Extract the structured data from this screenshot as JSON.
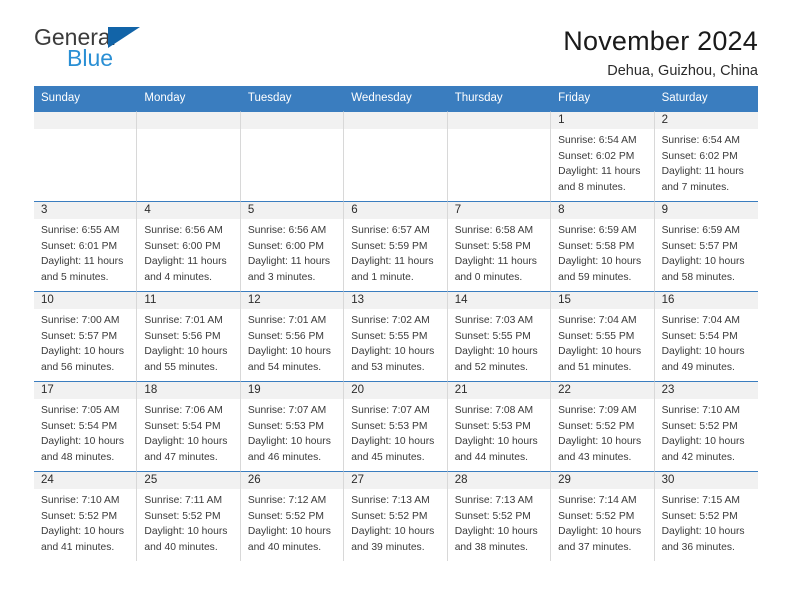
{
  "brand": {
    "word1": "General",
    "word2": "Blue",
    "triangle_color": "#1264a8",
    "word2_color": "#2a8fd4"
  },
  "header": {
    "title": "November 2024",
    "location": "Dehua, Guizhou, China"
  },
  "theme": {
    "header_blue": "#3a7dbf",
    "day_band_gray": "#f1f1f1",
    "text_color": "#3a3a3a"
  },
  "weekdays": [
    "Sunday",
    "Monday",
    "Tuesday",
    "Wednesday",
    "Thursday",
    "Friday",
    "Saturday"
  ],
  "weeks": [
    [
      {
        "day": "",
        "empty": true,
        "sunrise": "",
        "sunset": "",
        "daylight1": "",
        "daylight2": ""
      },
      {
        "day": "",
        "empty": true,
        "sunrise": "",
        "sunset": "",
        "daylight1": "",
        "daylight2": ""
      },
      {
        "day": "",
        "empty": true,
        "sunrise": "",
        "sunset": "",
        "daylight1": "",
        "daylight2": ""
      },
      {
        "day": "",
        "empty": true,
        "sunrise": "",
        "sunset": "",
        "daylight1": "",
        "daylight2": ""
      },
      {
        "day": "",
        "empty": true,
        "sunrise": "",
        "sunset": "",
        "daylight1": "",
        "daylight2": ""
      },
      {
        "day": "1",
        "empty": false,
        "sunrise": "Sunrise: 6:54 AM",
        "sunset": "Sunset: 6:02 PM",
        "daylight1": "Daylight: 11 hours",
        "daylight2": "and 8 minutes."
      },
      {
        "day": "2",
        "empty": false,
        "sunrise": "Sunrise: 6:54 AM",
        "sunset": "Sunset: 6:02 PM",
        "daylight1": "Daylight: 11 hours",
        "daylight2": "and 7 minutes."
      }
    ],
    [
      {
        "day": "3",
        "empty": false,
        "sunrise": "Sunrise: 6:55 AM",
        "sunset": "Sunset: 6:01 PM",
        "daylight1": "Daylight: 11 hours",
        "daylight2": "and 5 minutes."
      },
      {
        "day": "4",
        "empty": false,
        "sunrise": "Sunrise: 6:56 AM",
        "sunset": "Sunset: 6:00 PM",
        "daylight1": "Daylight: 11 hours",
        "daylight2": "and 4 minutes."
      },
      {
        "day": "5",
        "empty": false,
        "sunrise": "Sunrise: 6:56 AM",
        "sunset": "Sunset: 6:00 PM",
        "daylight1": "Daylight: 11 hours",
        "daylight2": "and 3 minutes."
      },
      {
        "day": "6",
        "empty": false,
        "sunrise": "Sunrise: 6:57 AM",
        "sunset": "Sunset: 5:59 PM",
        "daylight1": "Daylight: 11 hours",
        "daylight2": "and 1 minute."
      },
      {
        "day": "7",
        "empty": false,
        "sunrise": "Sunrise: 6:58 AM",
        "sunset": "Sunset: 5:58 PM",
        "daylight1": "Daylight: 11 hours",
        "daylight2": "and 0 minutes."
      },
      {
        "day": "8",
        "empty": false,
        "sunrise": "Sunrise: 6:59 AM",
        "sunset": "Sunset: 5:58 PM",
        "daylight1": "Daylight: 10 hours",
        "daylight2": "and 59 minutes."
      },
      {
        "day": "9",
        "empty": false,
        "sunrise": "Sunrise: 6:59 AM",
        "sunset": "Sunset: 5:57 PM",
        "daylight1": "Daylight: 10 hours",
        "daylight2": "and 58 minutes."
      }
    ],
    [
      {
        "day": "10",
        "empty": false,
        "sunrise": "Sunrise: 7:00 AM",
        "sunset": "Sunset: 5:57 PM",
        "daylight1": "Daylight: 10 hours",
        "daylight2": "and 56 minutes."
      },
      {
        "day": "11",
        "empty": false,
        "sunrise": "Sunrise: 7:01 AM",
        "sunset": "Sunset: 5:56 PM",
        "daylight1": "Daylight: 10 hours",
        "daylight2": "and 55 minutes."
      },
      {
        "day": "12",
        "empty": false,
        "sunrise": "Sunrise: 7:01 AM",
        "sunset": "Sunset: 5:56 PM",
        "daylight1": "Daylight: 10 hours",
        "daylight2": "and 54 minutes."
      },
      {
        "day": "13",
        "empty": false,
        "sunrise": "Sunrise: 7:02 AM",
        "sunset": "Sunset: 5:55 PM",
        "daylight1": "Daylight: 10 hours",
        "daylight2": "and 53 minutes."
      },
      {
        "day": "14",
        "empty": false,
        "sunrise": "Sunrise: 7:03 AM",
        "sunset": "Sunset: 5:55 PM",
        "daylight1": "Daylight: 10 hours",
        "daylight2": "and 52 minutes."
      },
      {
        "day": "15",
        "empty": false,
        "sunrise": "Sunrise: 7:04 AM",
        "sunset": "Sunset: 5:55 PM",
        "daylight1": "Daylight: 10 hours",
        "daylight2": "and 51 minutes."
      },
      {
        "day": "16",
        "empty": false,
        "sunrise": "Sunrise: 7:04 AM",
        "sunset": "Sunset: 5:54 PM",
        "daylight1": "Daylight: 10 hours",
        "daylight2": "and 49 minutes."
      }
    ],
    [
      {
        "day": "17",
        "empty": false,
        "sunrise": "Sunrise: 7:05 AM",
        "sunset": "Sunset: 5:54 PM",
        "daylight1": "Daylight: 10 hours",
        "daylight2": "and 48 minutes."
      },
      {
        "day": "18",
        "empty": false,
        "sunrise": "Sunrise: 7:06 AM",
        "sunset": "Sunset: 5:54 PM",
        "daylight1": "Daylight: 10 hours",
        "daylight2": "and 47 minutes."
      },
      {
        "day": "19",
        "empty": false,
        "sunrise": "Sunrise: 7:07 AM",
        "sunset": "Sunset: 5:53 PM",
        "daylight1": "Daylight: 10 hours",
        "daylight2": "and 46 minutes."
      },
      {
        "day": "20",
        "empty": false,
        "sunrise": "Sunrise: 7:07 AM",
        "sunset": "Sunset: 5:53 PM",
        "daylight1": "Daylight: 10 hours",
        "daylight2": "and 45 minutes."
      },
      {
        "day": "21",
        "empty": false,
        "sunrise": "Sunrise: 7:08 AM",
        "sunset": "Sunset: 5:53 PM",
        "daylight1": "Daylight: 10 hours",
        "daylight2": "and 44 minutes."
      },
      {
        "day": "22",
        "empty": false,
        "sunrise": "Sunrise: 7:09 AM",
        "sunset": "Sunset: 5:52 PM",
        "daylight1": "Daylight: 10 hours",
        "daylight2": "and 43 minutes."
      },
      {
        "day": "23",
        "empty": false,
        "sunrise": "Sunrise: 7:10 AM",
        "sunset": "Sunset: 5:52 PM",
        "daylight1": "Daylight: 10 hours",
        "daylight2": "and 42 minutes."
      }
    ],
    [
      {
        "day": "24",
        "empty": false,
        "sunrise": "Sunrise: 7:10 AM",
        "sunset": "Sunset: 5:52 PM",
        "daylight1": "Daylight: 10 hours",
        "daylight2": "and 41 minutes."
      },
      {
        "day": "25",
        "empty": false,
        "sunrise": "Sunrise: 7:11 AM",
        "sunset": "Sunset: 5:52 PM",
        "daylight1": "Daylight: 10 hours",
        "daylight2": "and 40 minutes."
      },
      {
        "day": "26",
        "empty": false,
        "sunrise": "Sunrise: 7:12 AM",
        "sunset": "Sunset: 5:52 PM",
        "daylight1": "Daylight: 10 hours",
        "daylight2": "and 40 minutes."
      },
      {
        "day": "27",
        "empty": false,
        "sunrise": "Sunrise: 7:13 AM",
        "sunset": "Sunset: 5:52 PM",
        "daylight1": "Daylight: 10 hours",
        "daylight2": "and 39 minutes."
      },
      {
        "day": "28",
        "empty": false,
        "sunrise": "Sunrise: 7:13 AM",
        "sunset": "Sunset: 5:52 PM",
        "daylight1": "Daylight: 10 hours",
        "daylight2": "and 38 minutes."
      },
      {
        "day": "29",
        "empty": false,
        "sunrise": "Sunrise: 7:14 AM",
        "sunset": "Sunset: 5:52 PM",
        "daylight1": "Daylight: 10 hours",
        "daylight2": "and 37 minutes."
      },
      {
        "day": "30",
        "empty": false,
        "sunrise": "Sunrise: 7:15 AM",
        "sunset": "Sunset: 5:52 PM",
        "daylight1": "Daylight: 10 hours",
        "daylight2": "and 36 minutes."
      }
    ]
  ]
}
